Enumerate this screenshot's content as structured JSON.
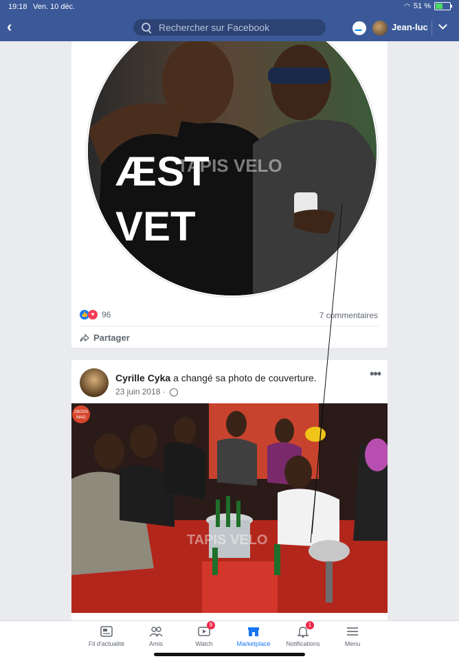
{
  "status_bar": {
    "time": "19:18",
    "date": "Ven. 10 déc.",
    "battery": "51 %",
    "battery_level": 0.51
  },
  "header": {
    "search_placeholder": "Rechercher sur Facebook",
    "user_name": "Jean-luc",
    "icons": [
      "back-icon",
      "search-icon",
      "messenger-icon",
      "chevron-down-icon"
    ]
  },
  "post1": {
    "watermark": "TAPIS VELO",
    "shirt_text": [
      "ÆST",
      "VET"
    ],
    "reaction_count": "96",
    "comments": "7 commentaires",
    "share_label": "Partager"
  },
  "post2": {
    "author": "Cyrille Cyka",
    "action": "a changé sa photo de couverture.",
    "date": "23 juin 2018",
    "more": "•••",
    "photo_watermark": "TAPIS VELO",
    "photo_badge": [
      "2BOSS",
      "MAG"
    ]
  },
  "tabbar": {
    "tabs": [
      {
        "label": "Fil d'actualité",
        "icon": "news-feed-icon"
      },
      {
        "label": "Amis",
        "icon": "friends-icon"
      },
      {
        "label": "Watch",
        "icon": "watch-icon",
        "badge": "9"
      },
      {
        "label": "Marketplace",
        "icon": "marketplace-icon",
        "active": true
      },
      {
        "label": "Notifications",
        "icon": "bell-icon",
        "badge": "1"
      },
      {
        "label": "Menu",
        "icon": "menu-icon"
      }
    ]
  },
  "colors": {
    "facebook_blue": "#3b5998",
    "active_tab": "#1877f2",
    "badge": "#f02849"
  }
}
